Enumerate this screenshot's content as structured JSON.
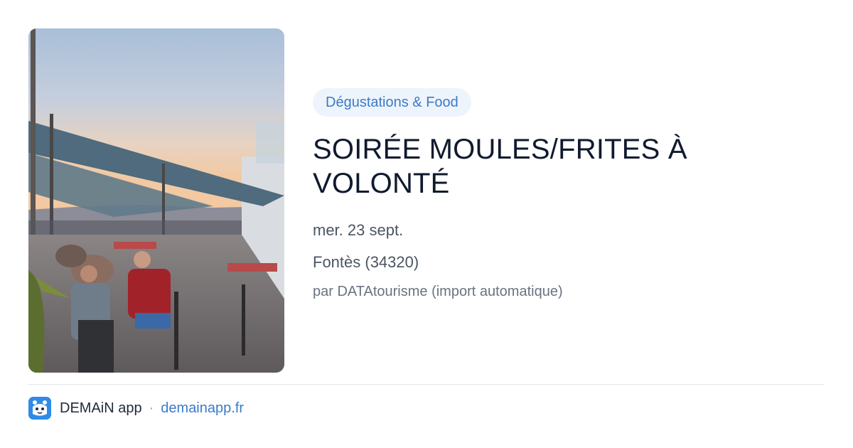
{
  "event": {
    "category": "Dégustations & Food",
    "title": "SOIRÉE MOULES/FRITES À VOLONTÉ",
    "date": "mer. 23 sept.",
    "location": "Fontès (34320)",
    "source": "par DATAtourisme (import automatique)"
  },
  "photo": {
    "icon": "event-photo"
  },
  "footer": {
    "app_name": "DEMAiN app",
    "separator": "·",
    "link": "demainapp.fr",
    "logo_icon": "demain-logo-icon"
  },
  "colors": {
    "accent": "#3b7bc8",
    "category_bg": "#eef4fb",
    "title": "#0f1a2e",
    "logo": "#2f8be6"
  }
}
